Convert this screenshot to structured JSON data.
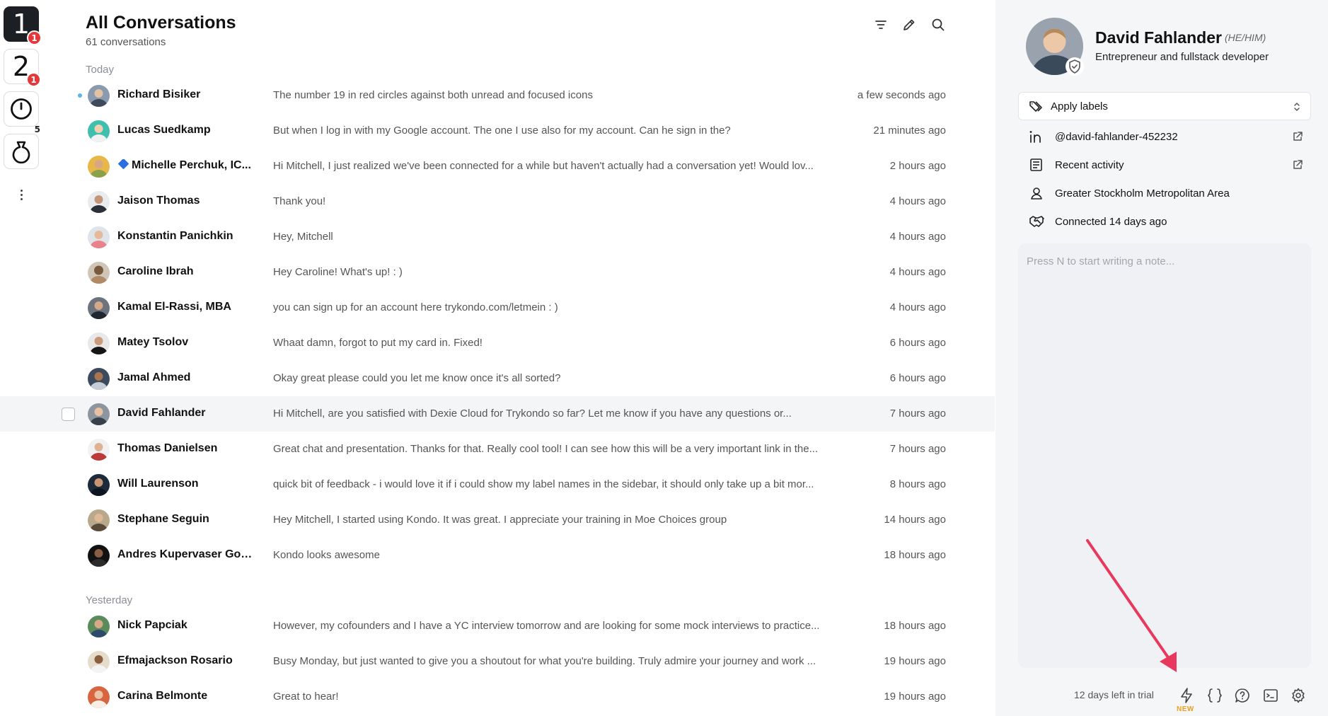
{
  "rail": {
    "items": [
      {
        "label": "1",
        "badge": "1",
        "active": true
      },
      {
        "label": "2",
        "badge": "1",
        "active": false
      },
      {
        "icon": "clock-icon",
        "count": "5"
      },
      {
        "icon": "snooze-bag-icon"
      }
    ]
  },
  "list": {
    "title": "All Conversations",
    "subtitle": "61 conversations",
    "sections": [
      "Today",
      "Yesterday"
    ],
    "rows": [
      {
        "name": "Richard Bisiker",
        "preview": "The number 19 in red circles against both unread and focused icons",
        "time": "a few seconds ago",
        "unread": true
      },
      {
        "name": "Lucas Suedkamp",
        "preview": "But when I log in with my Google account. The one I use also for my account. Can he sign in the?",
        "time": "21 minutes ago"
      },
      {
        "name": "Michelle Perchuk, IC...",
        "preview": "Hi Mitchell, I just realized we've been connected for a while but haven't actually had a conversation yet! Would lov...",
        "time": "2 hours ago"
      },
      {
        "name": "Jaison Thomas",
        "preview": "Thank you!",
        "time": "4 hours ago"
      },
      {
        "name": "Konstantin Panichkin",
        "preview": "Hey, Mitchell",
        "time": "4 hours ago"
      },
      {
        "name": "Caroline Ibrah",
        "preview": "Hey Caroline! What's up! : )",
        "time": "4 hours ago"
      },
      {
        "name": "Kamal El-Rassi, MBA",
        "preview": "you can sign up for an account here trykondo.com/letmein : )",
        "time": "4 hours ago"
      },
      {
        "name": "Matey Tsolov",
        "preview": "Whaat damn, forgot to put my card in. Fixed!",
        "time": "6 hours ago"
      },
      {
        "name": "Jamal Ahmed",
        "preview": "Okay great please could you let me know once it's all sorted?",
        "time": "6 hours ago"
      },
      {
        "name": "David Fahlander",
        "preview": "Hi Mitchell, are you satisfied with Dexie Cloud for Trykondo so far? Let me know if you have any questions or...",
        "time": "7 hours ago",
        "selected": true
      },
      {
        "name": "Thomas Danielsen",
        "preview": "Great chat and presentation. Thanks for that. Really cool tool! I can see how this will be a very important link in the...",
        "time": "7 hours ago"
      },
      {
        "name": "Will Laurenson",
        "preview": "quick bit of feedback - i would love it if i could show my label names in the sidebar, it should only take up a bit mor...",
        "time": "8 hours ago"
      },
      {
        "name": "Stephane Seguin",
        "preview": "Hey Mitchell, I started using Kondo. It was great. I appreciate your training in Moe Choices group",
        "time": "14 hours ago"
      },
      {
        "name": "Andres Kupervaser Gould",
        "preview": "Kondo looks awesome",
        "time": "18 hours ago"
      },
      {
        "name": "Nick Papciak",
        "preview": "However, my cofounders and I have a YC interview tomorrow and are looking for some mock interviews to practice...",
        "time": "18 hours ago"
      },
      {
        "name": "Efmajackson Rosario",
        "preview": "Busy Monday, but just wanted to give you a shoutout for what you're building. Truly admire your journey and work ...",
        "time": "19 hours ago"
      },
      {
        "name": "Carina Belmonte",
        "preview": "Great to hear!",
        "time": "19 hours ago"
      }
    ]
  },
  "profile": {
    "name": "David Fahlander",
    "pronoun": "(HE/HIM)",
    "headline": "Entrepreneur and fullstack developer",
    "apply_labels": "Apply labels",
    "linkedin": "@david-fahlander-452232",
    "recent_activity": "Recent activity",
    "location": "Greater Stockholm Metropolitan Area",
    "connected": "Connected 14 days ago",
    "note_placeholder": "Press N to start writing a note..."
  },
  "footer": {
    "trial": "12 days left in trial",
    "new_tag": "NEW"
  },
  "colors": {
    "accent_badge": "#e5383b",
    "unread_dot": "#5cb3ee",
    "arrow": "#e8385e",
    "new_tag": "#f0a020"
  }
}
